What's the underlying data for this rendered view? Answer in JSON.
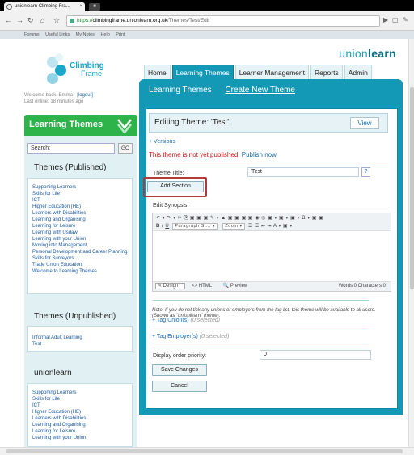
{
  "browser": {
    "tab_title": "unionlearn Climbing Fra...",
    "tab_close": "×",
    "newtab_label": "■",
    "url_scheme": "https://",
    "url_host": "climbingframe.unionlearn.org.uk",
    "url_path": "/Themes/Test/Edit"
  },
  "top_links": [
    "Forums",
    "Useful Links",
    "My Notes",
    "Help",
    "Print"
  ],
  "logo": {
    "line1": "Climbing",
    "line2": "Frame"
  },
  "brand": {
    "part1": "union",
    "part2": "learn"
  },
  "welcome": {
    "prefix": "Welcome back, Emma - ",
    "logout": "[logout]",
    "last_online": "Last online: 18 minutes ago"
  },
  "main_nav": [
    "Home",
    "Learning Themes",
    "Learner Management",
    "Reports",
    "Admin"
  ],
  "sub_nav": {
    "item1": "Learning Themes",
    "item2": "Create New Theme"
  },
  "editor_page": {
    "title": "Editing Theme: 'Test'",
    "view_button": "View",
    "versions": "+ Versions",
    "not_published": "This theme is not yet published.",
    "publish_now": "Publish now.",
    "theme_title_label": "Theme Title:",
    "theme_title_value": "Test",
    "help": "?",
    "add_section": "Add Section",
    "edit_synopsis": "Edit Synopsis:",
    "toolbar_row1": "↶ ▾ ↷ ▾  ✂ ⎘ ▣ ▣ ▣ ✎ ▾  ▲ ▣ ▣ ▣ ▣ ◉ ◎ ▣ ▾  ▣ ▾  ▣ ▾  Ω ▾  ▣ ▣",
    "toolbar_row2_bold": "B",
    "toolbar_row2_italic": "I",
    "toolbar_row2_underline": "U",
    "paragraph_style": "Paragraph St... ▾",
    "zoom": "Zoom ▾",
    "toolbar_row2_rest": "☰ ☰ ⇤ ⇥ A ▾ ▣ ▾",
    "mode_design": "Design",
    "mode_html": "HTML",
    "mode_preview": "Preview",
    "counts": "Words 0  Characters 0",
    "note": "Note: If you do not tick any unions or employers from the tag list, this theme will be available to all users. (Shown as \"unionlearn\" theme).",
    "tag_unions": "+ Tag Union(s)",
    "tag_unions_hint": "(0 selected)",
    "tag_employers": "+ Tag Employer(s)",
    "tag_employers_hint": "(0 selected)",
    "display_order_label": "Display order priority:",
    "display_order_value": "0",
    "save_changes": "Save Changes",
    "cancel": "Cancel"
  },
  "sidebar": {
    "header": "Learning Themes",
    "search_placeholder": "Search:",
    "go": "GO",
    "published_title": "Themes (Published)",
    "published": [
      "Supporting Learners",
      "Skills for Life",
      "ICT",
      "Higher Education (HE)",
      "Learners with Disabilities",
      "Learning and Organising",
      "Learning for Leisure",
      "Learning with Usdaw",
      "Learning with your Union",
      "Moving into Management",
      "Personal Development and Career Planning",
      "Skills for Surveyors",
      "Trade Union Education",
      "Welcome to Learning Themes"
    ],
    "unpublished_title": "Themes (Unpublished)",
    "unpublished": [
      "Informal Adult Learning",
      "Test"
    ],
    "unionlearn_title": "unionlearn",
    "unionlearn": [
      "Supporting Learners",
      "Skills for Life",
      "ICT",
      "Higher Education (HE)",
      "Learners with Disabilities",
      "Learning and Organising",
      "Learning for Leisure",
      "Learning with your Union"
    ]
  },
  "colors": {
    "teal": "#1398b5",
    "green": "#2db34a",
    "link": "#1a6bb0",
    "alert": "#cc1111",
    "highlight": "#b23a3a"
  }
}
